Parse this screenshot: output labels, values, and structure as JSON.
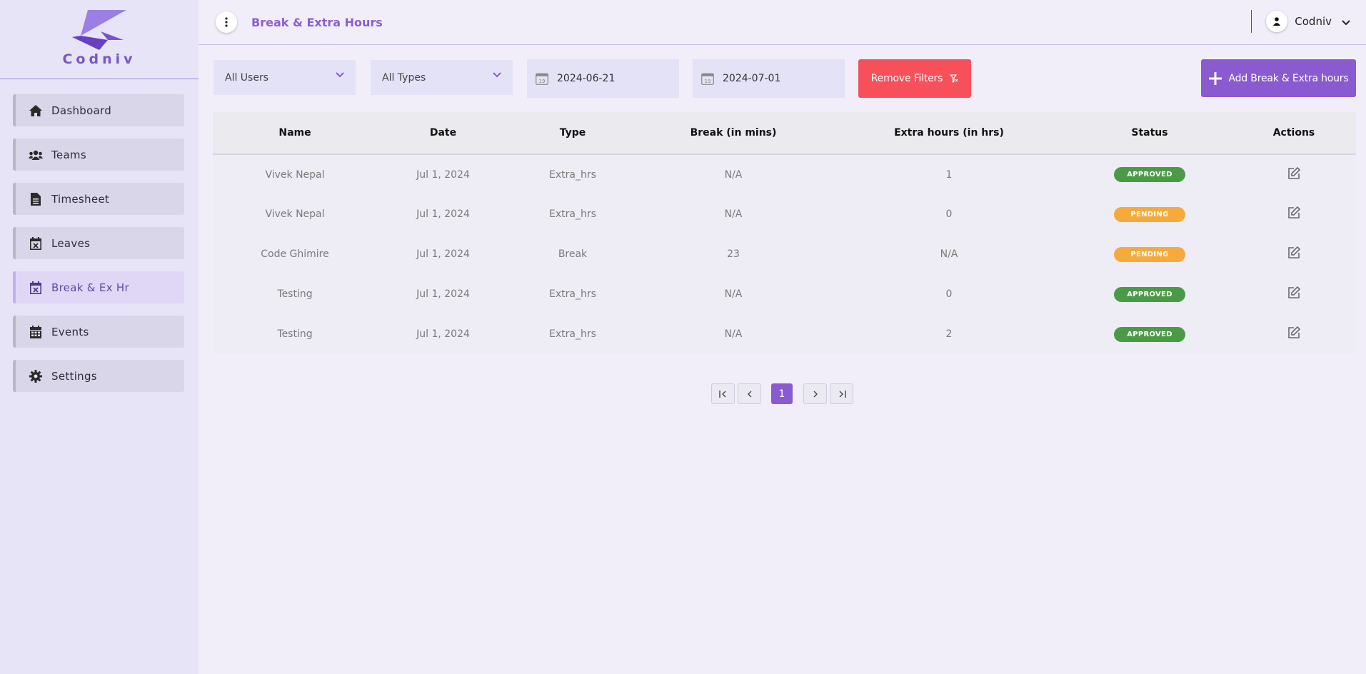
{
  "brand": {
    "name": "Codniv"
  },
  "sidebar": {
    "items": [
      {
        "label": "Dashboard",
        "icon": "home-icon",
        "active": false
      },
      {
        "label": "Teams",
        "icon": "users-icon",
        "active": false
      },
      {
        "label": "Timesheet",
        "icon": "file-icon",
        "active": false
      },
      {
        "label": "Leaves",
        "icon": "calendar-x-icon",
        "active": false
      },
      {
        "label": "Break & Ex Hr",
        "icon": "calendar-x-icon",
        "active": true
      },
      {
        "label": "Events",
        "icon": "calendar-icon",
        "active": false
      },
      {
        "label": "Settings",
        "icon": "gear-icon",
        "active": false
      }
    ]
  },
  "header": {
    "title": "Break & Extra Hours",
    "user": "Codniv"
  },
  "filters": {
    "user_select": "All Users",
    "type_select": "All Types",
    "start_date": "2024-06-21",
    "end_date": "2024-07-01",
    "remove_label": "Remove Filters",
    "add_label": "Add Break & Extra hours"
  },
  "table": {
    "columns": [
      "Name",
      "Date",
      "Type",
      "Break (in mins)",
      "Extra hours (in hrs)",
      "Status",
      "Actions"
    ],
    "rows": [
      {
        "name": "Vivek Nepal",
        "date": "Jul 1, 2024",
        "type": "Extra_hrs",
        "break": "N/A",
        "extra": "1",
        "status": "APPROVED"
      },
      {
        "name": "Vivek Nepal",
        "date": "Jul 1, 2024",
        "type": "Extra_hrs",
        "break": "N/A",
        "extra": "0",
        "status": "PENDING"
      },
      {
        "name": "Code Ghimire",
        "date": "Jul 1, 2024",
        "type": "Break",
        "break": "23",
        "extra": "N/A",
        "status": "PENDING"
      },
      {
        "name": "Testing",
        "date": "Jul 1, 2024",
        "type": "Extra_hrs",
        "break": "N/A",
        "extra": "0",
        "status": "APPROVED"
      },
      {
        "name": "Testing",
        "date": "Jul 1, 2024",
        "type": "Extra_hrs",
        "break": "N/A",
        "extra": "2",
        "status": "APPROVED"
      }
    ]
  },
  "pagination": {
    "current": "1"
  },
  "colors": {
    "accent": "#8a5ad0",
    "danger": "#f7505a",
    "approved": "#4a9b45",
    "pending": "#f6aa3c"
  }
}
